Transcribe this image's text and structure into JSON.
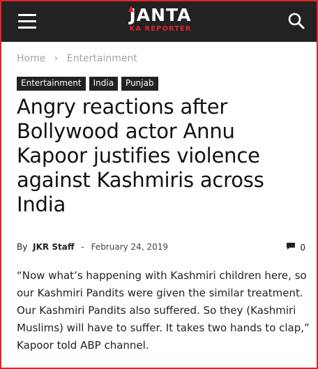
{
  "header": {
    "logo_main": "JANTA",
    "logo_sub": "KA REPORTER",
    "menu_icon": "hamburger-menu-icon",
    "search_icon": "search-icon",
    "background": "#222222",
    "accent": "#e0242b"
  },
  "breadcrumb": {
    "home": "Home",
    "separator": "›",
    "current": "Entertainment"
  },
  "tags": [
    "Entertainment",
    "India",
    "Punjab"
  ],
  "article": {
    "title": "Angry reactions after Bollywood actor Annu Kapoor justifies violence against Kashmiris across India",
    "by_label": "By",
    "author": "JKR Staff",
    "dash": "-",
    "date": "February 24, 2019",
    "comments_icon": "comment-icon",
    "comments_count": "0",
    "body": "“Now what’s happening with Kashmiri children here, so our Kashmiri Pandits were given the similar treatment. Our Kashmiri Pandits also suffered. So they (Kashmiri Muslims) will have to suffer. It takes two hands to clap,” Kapoor told ABP channel."
  }
}
